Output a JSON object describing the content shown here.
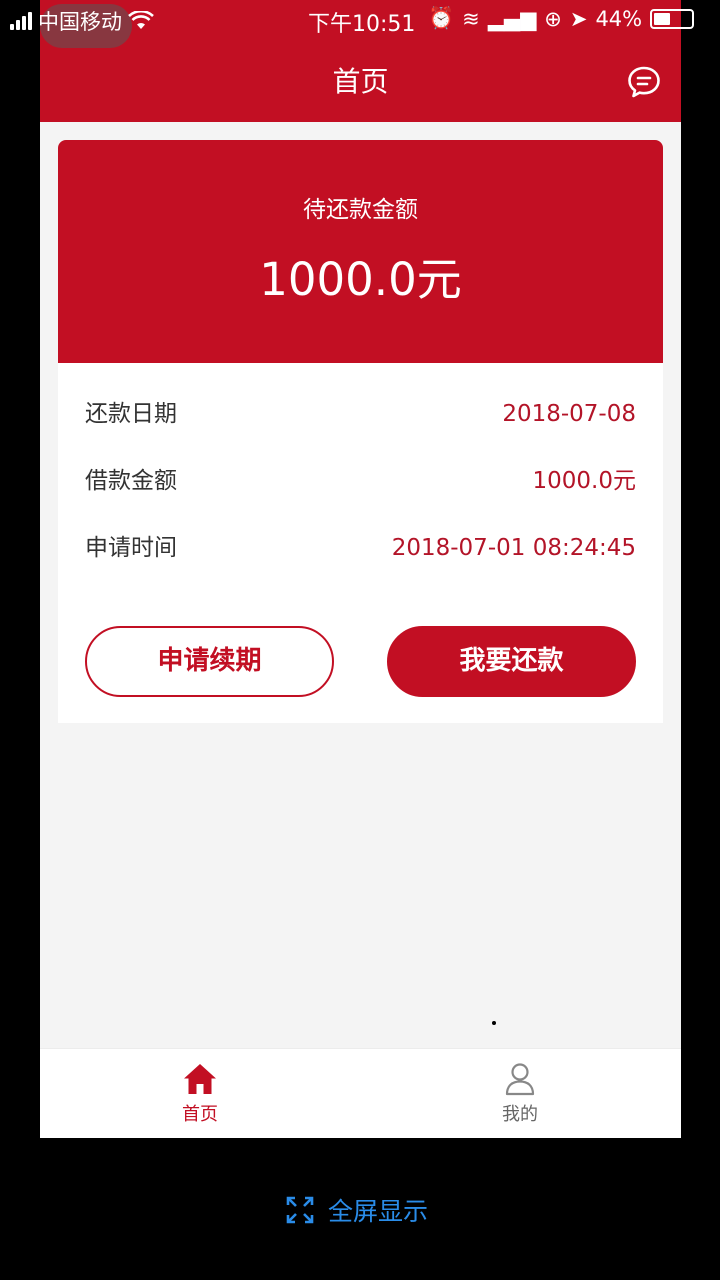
{
  "status_bar": {
    "carrier": "中国移动",
    "time": "下午10:51",
    "battery": "44%"
  },
  "header": {
    "title": "首页"
  },
  "card": {
    "due_label": "待还款金额",
    "due_amount": "1000.0元",
    "rows": [
      {
        "label": "还款日期",
        "value": "2018-07-08"
      },
      {
        "label": "借款金额",
        "value": "1000.0元"
      },
      {
        "label": "申请时间",
        "value": "2018-07-01 08:24:45"
      }
    ],
    "renew_button": "申请续期",
    "repay_button": "我要还款"
  },
  "tabbar": {
    "home": "首页",
    "me": "我的"
  },
  "fullscreen_label": "全屏显示",
  "colors": {
    "brand": "#c20f23",
    "value_text": "#b31428",
    "link": "#2a8ce8"
  },
  "icons": {
    "message": "chat-bubble-icon",
    "home": "home-icon",
    "me": "user-icon",
    "fullscreen": "expand-icon"
  }
}
